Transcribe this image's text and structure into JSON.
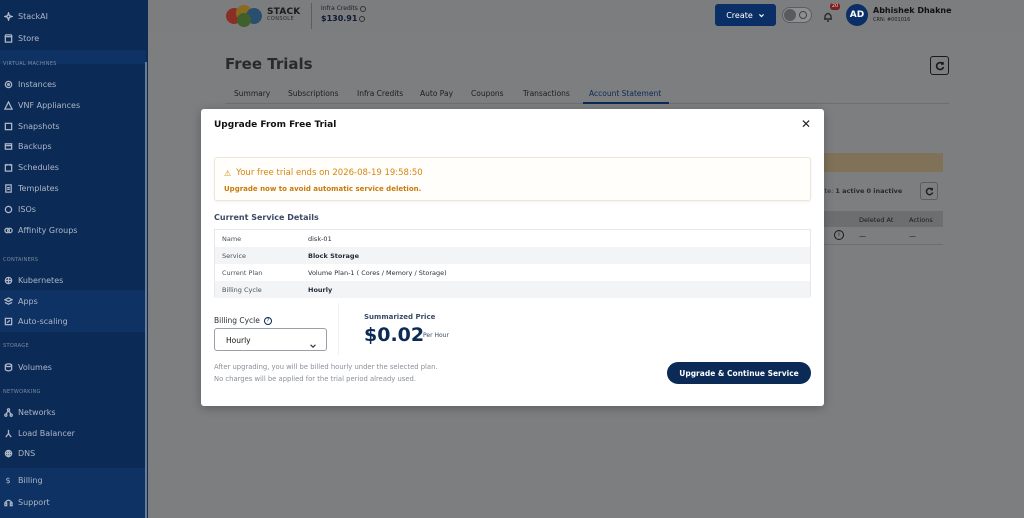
{
  "sidebar": {
    "top_items": [
      {
        "label": "StackAI",
        "icon": "sparkle-icon"
      },
      {
        "label": "Store",
        "icon": "store-icon"
      }
    ],
    "sections": [
      {
        "title": "VIRTUAL MACHINES",
        "items": [
          {
            "label": "Instances",
            "icon": "instances-icon"
          },
          {
            "label": "VNF Appliances",
            "icon": "vnf-icon"
          },
          {
            "label": "Snapshots",
            "icon": "snapshot-icon"
          },
          {
            "label": "Backups",
            "icon": "backup-icon"
          },
          {
            "label": "Schedules",
            "icon": "schedule-icon"
          },
          {
            "label": "Templates",
            "icon": "template-icon"
          },
          {
            "label": "ISOs",
            "icon": "iso-icon"
          },
          {
            "label": "Affinity Groups",
            "icon": "affinity-icon"
          }
        ]
      },
      {
        "title": "CONTAINERS",
        "items": [
          {
            "label": "Kubernetes",
            "icon": "kubernetes-icon"
          },
          {
            "label": "Apps",
            "icon": "apps-icon"
          },
          {
            "label": "Auto-scaling",
            "icon": "autoscaling-icon"
          }
        ]
      },
      {
        "title": "STORAGE",
        "items": [
          {
            "label": "Volumes",
            "icon": "volume-icon"
          }
        ]
      },
      {
        "title": "NETWORKING",
        "items": [
          {
            "label": "Networks",
            "icon": "network-icon"
          },
          {
            "label": "Load Balancer",
            "icon": "loadbalancer-icon"
          },
          {
            "label": "DNS",
            "icon": "dns-icon"
          }
        ]
      }
    ],
    "bottom_items": [
      {
        "label": "Billing",
        "icon": "dollar-icon"
      },
      {
        "label": "Support",
        "icon": "headset-icon"
      }
    ]
  },
  "header": {
    "logo_line1": "STACK",
    "logo_line2": "CONSOLE",
    "credits_label": "Infra Credits",
    "credits_value": "$130.91",
    "create_label": "Create",
    "notification_count": "20",
    "avatar_initials": "AD",
    "user_name": "Abhishek Dhakne",
    "user_sub": "CRN: #001016"
  },
  "page": {
    "title": "Free Trials",
    "tabs": [
      "Summary",
      "Subscriptions",
      "Infra Credits",
      "Auto Pay",
      "Coupons",
      "Transactions",
      "Account Statement"
    ],
    "active_tab": "Account Statement",
    "status_prefix": "tate:",
    "status_active": "1 active",
    "status_inactive": "0 inactive",
    "table_headers": [
      "Deleted At",
      "Actions"
    ],
    "table_row": {
      "deleted_at": "—",
      "actions": "—"
    }
  },
  "modal": {
    "title": "Upgrade From Free Trial",
    "alert_title": "Your free trial ends on 2026-08-19 19:58:50",
    "alert_sub": "Upgrade now to avoid automatic service deletion.",
    "section_title": "Current Service Details",
    "details": [
      {
        "key": "Name",
        "value": "disk-01",
        "bold": false
      },
      {
        "key": "Service",
        "value": "Block Storage",
        "bold": true
      },
      {
        "key": "Current Plan",
        "value": "Volume Plan-1 ( Cores / Memory / Storage)",
        "bold": false
      },
      {
        "key": "Billing Cycle",
        "value": "Hourly",
        "bold": true
      }
    ],
    "billing_cycle_label": "Billing Cycle",
    "billing_cycle_value": "Hourly",
    "summarized_price_label": "Summarized Price",
    "price": "$0.02",
    "price_unit": "Per Hour",
    "note_line1": "After upgrading, you will be billed hourly under the selected plan.",
    "note_line2": "No charges will be applied for the trial period already used.",
    "upgrade_button": "Upgrade & Continue Service"
  },
  "colors": {
    "sidebar_bg": "#0b2a56",
    "primary": "#0b2a56",
    "warning": "#d68612",
    "overlay": "#7d7e80"
  }
}
